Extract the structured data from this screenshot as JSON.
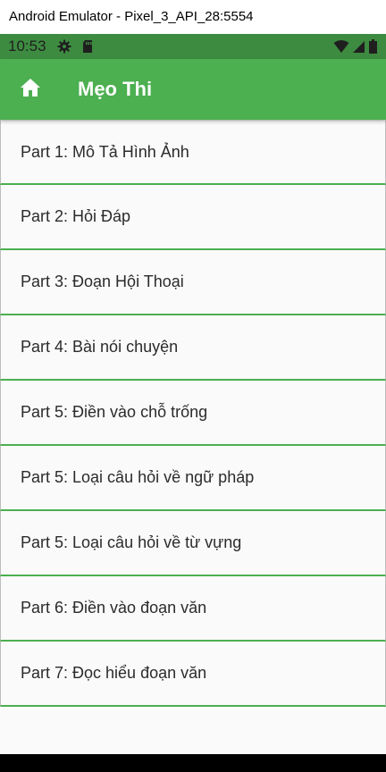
{
  "window": {
    "title": "Android Emulator - Pixel_3_API_28:5554"
  },
  "status_bar": {
    "time": "10:53",
    "icons": [
      "gear-icon",
      "sd-card-icon",
      "wifi-icon",
      "signal-icon",
      "battery-icon"
    ],
    "color": "#3d8b40"
  },
  "app_bar": {
    "title": "Mẹo Thi",
    "home_icon": "home-icon",
    "color": "#4caf50"
  },
  "list": {
    "items": [
      {
        "label": "Part 1: Mô Tả Hình Ảnh"
      },
      {
        "label": "Part 2: Hỏi Đáp"
      },
      {
        "label": "Part 3: Đoạn Hội Thoại"
      },
      {
        "label": "Part 4: Bài nói chuyện"
      },
      {
        "label": "Part 5: Điền vào chỗ trống"
      },
      {
        "label": "Part 5: Loại câu hỏi về ngữ pháp"
      },
      {
        "label": "Part 5: Loại câu hỏi về từ vựng"
      },
      {
        "label": "Part 6: Điền vào đoạn văn"
      },
      {
        "label": "Part 7: Đọc hiểu đoạn văn"
      }
    ],
    "divider_color": "#4caf50"
  }
}
